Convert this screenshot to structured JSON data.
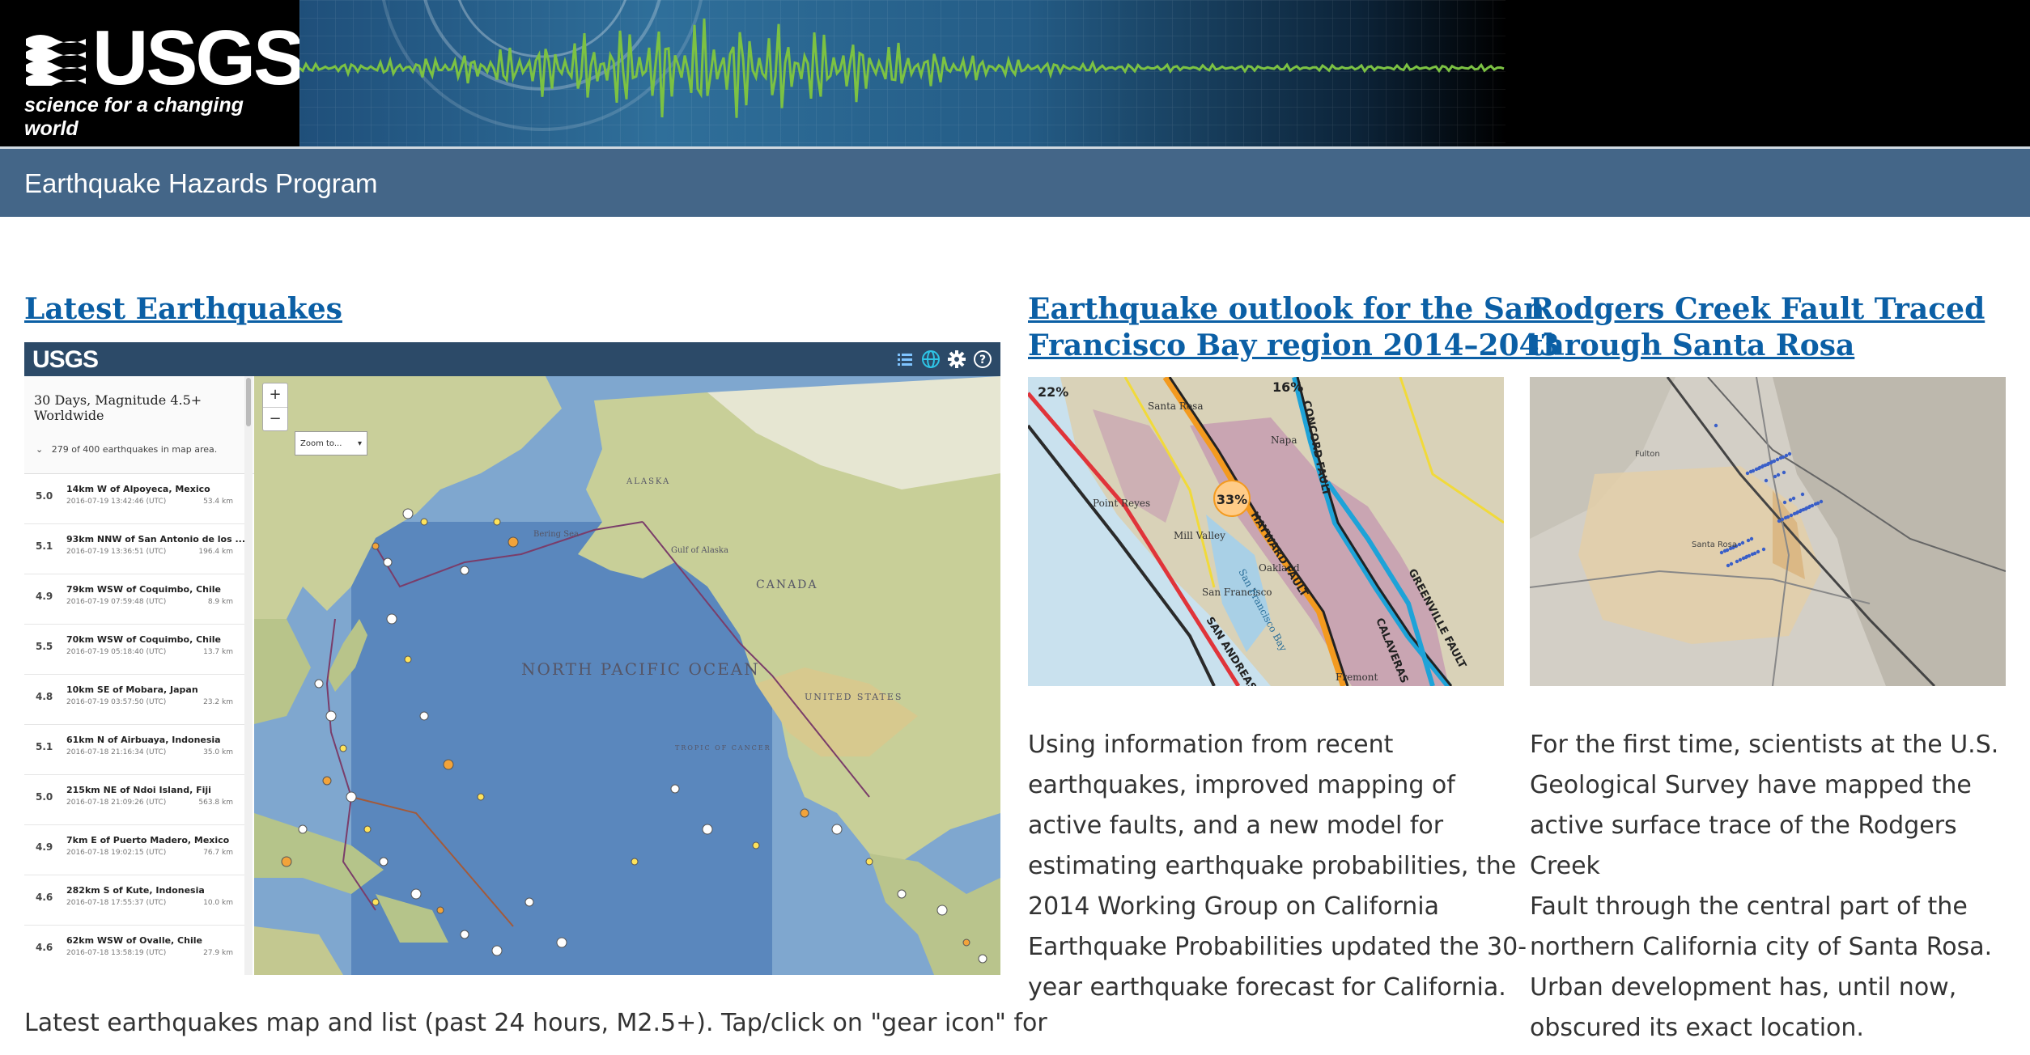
{
  "header": {
    "logo_text": "USGS",
    "logo_tagline": "science for a changing world",
    "program_title": "Earthquake Hazards Program"
  },
  "columns": [
    {
      "title": "Latest Earthquakes",
      "body": "Latest earthquakes map and list (past 24 hours, M2.5+). Tap/click on \"gear icon\" for"
    },
    {
      "title_line1": "Earthquake outlook for the San",
      "title_line2": "Francisco Bay region 2014–2043",
      "body_lines": [
        "Using information from recent",
        "earthquakes, improved mapping of",
        "active faults, and a new model for",
        "estimating earthquake probabilities, the",
        "2014 Working Group on California",
        "Earthquake Probabilities updated the 30-",
        "year earthquake forecast for California."
      ]
    },
    {
      "title_line1": "Rodgers Creek Fault Traced",
      "title_line2": "through Santa Rosa",
      "body_lines": [
        "For the first time, scientists at the U.S.",
        "Geological Survey have mapped the",
        "active surface trace of the Rodgers Creek",
        "Fault through the central part of the",
        "northern California city of Santa Rosa.",
        "Urban development has, until now,",
        "obscured its exact location."
      ]
    }
  ],
  "quake_app": {
    "logo": "USGS",
    "icons": [
      "list-icon",
      "globe-icon",
      "gear-icon",
      "help-icon"
    ],
    "list_title": "30 Days, Magnitude 4.5+ Worldwide",
    "count_text": "279 of 400 earthquakes in map area.",
    "zoom_in": "+",
    "zoom_out": "−",
    "zoom_select": "Zoom to...",
    "quakes": [
      {
        "mag": "5.0",
        "place": "14km W of Alpoyeca, Mexico",
        "time": "2016-07-19 13:42:46 (UTC)",
        "dist": "53.4 km"
      },
      {
        "mag": "5.1",
        "place": "93km NNW of San Antonio de los ...",
        "time": "2016-07-19 13:36:51 (UTC)",
        "dist": "196.4 km"
      },
      {
        "mag": "4.9",
        "place": "79km WSW of Coquimbo, Chile",
        "time": "2016-07-19 07:59:48 (UTC)",
        "dist": "8.9 km"
      },
      {
        "mag": "5.5",
        "place": "70km WSW of Coquimbo, Chile",
        "time": "2016-07-19 05:18:40 (UTC)",
        "dist": "13.7 km"
      },
      {
        "mag": "4.8",
        "place": "10km SE of Mobara, Japan",
        "time": "2016-07-19 03:57:50 (UTC)",
        "dist": "23.2 km"
      },
      {
        "mag": "5.1",
        "place": "61km N of Airbuaya, Indonesia",
        "time": "2016-07-18 21:16:34 (UTC)",
        "dist": "35.0 km"
      },
      {
        "mag": "5.0",
        "place": "215km NE of Ndoi Island, Fiji",
        "time": "2016-07-18 21:09:26 (UTC)",
        "dist": "563.8 km"
      },
      {
        "mag": "4.9",
        "place": "7km E of Puerto Madero, Mexico",
        "time": "2016-07-18 19:02:15 (UTC)",
        "dist": "76.7 km"
      },
      {
        "mag": "4.6",
        "place": "282km S of Kute, Indonesia",
        "time": "2016-07-18 17:55:37 (UTC)",
        "dist": "10.0 km"
      },
      {
        "mag": "4.6",
        "place": "62km WSW of Ovalle, Chile",
        "time": "2016-07-18 13:58:19 (UTC)",
        "dist": "27.9 km"
      }
    ],
    "map_labels": {
      "pacific": "NORTH PACIFIC OCEAN",
      "canada": "CANADA",
      "us": "UNITED STATES",
      "alaska": "ALASKA",
      "bering": "Bering Sea",
      "gulf_alaska": "Gulf of Alaska",
      "tropic_cancer": "TROPIC OF CANCER"
    }
  },
  "sf_map": {
    "pct_22": "22%",
    "pct_16": "16%",
    "pct_33": "33%",
    "places": [
      "Santa Rosa",
      "Napa",
      "Point Reyes",
      "Mill Valley",
      "San Francisco",
      "Oakland",
      "Fremont",
      "San Francisco Bay"
    ],
    "faults": [
      "CONCORD FAULT",
      "HAYWARD FAULT",
      "GREENVILLE FAULT",
      "CALAVERAS",
      "SAN ANDREAS F."
    ]
  },
  "rc_map": {
    "places": [
      "Fulton",
      "Santa Rosa"
    ]
  }
}
